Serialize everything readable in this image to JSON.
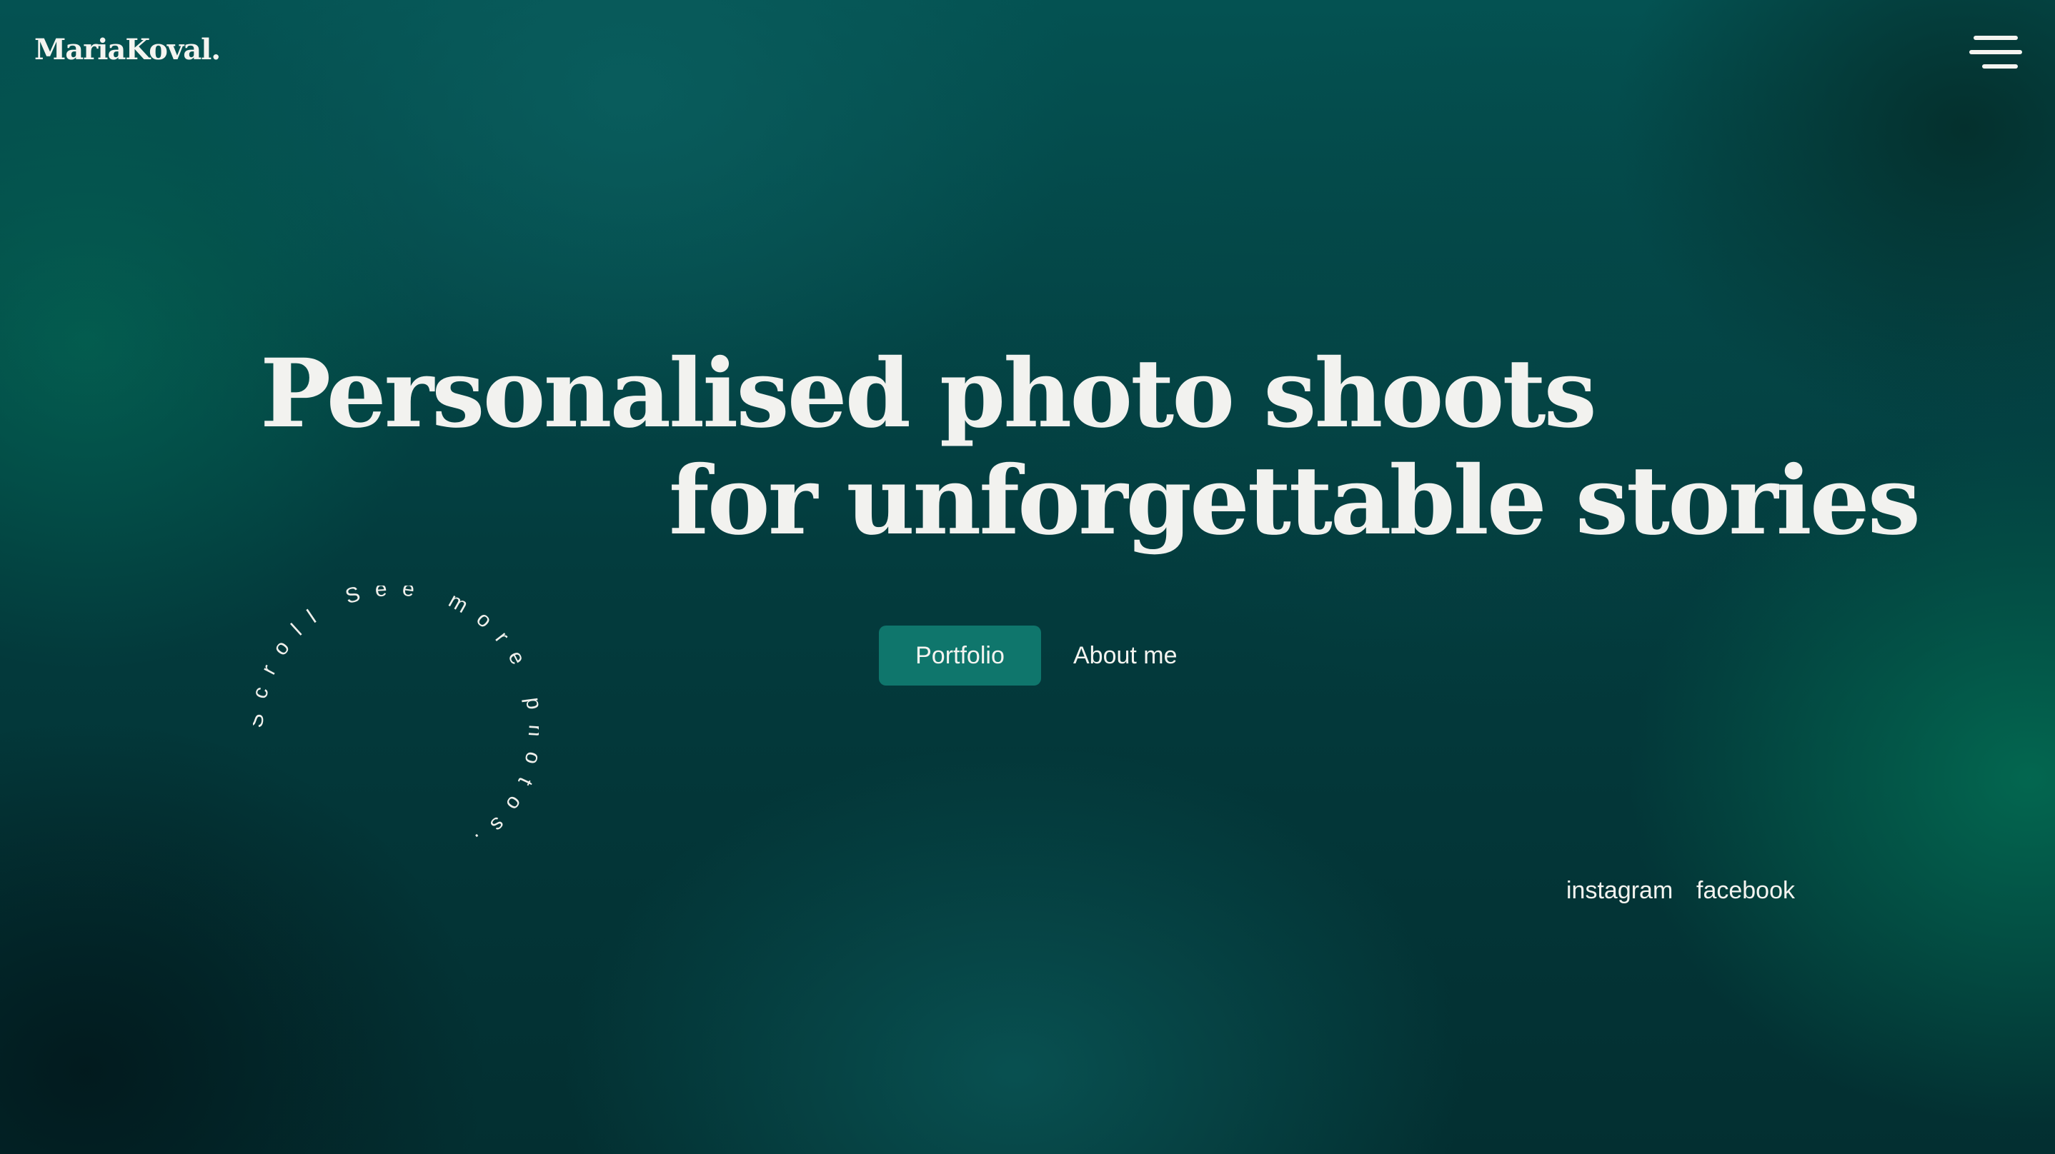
{
  "header": {
    "logo_text": "MariaKoval.",
    "menu_icon": "hamburger-menu-icon"
  },
  "hero": {
    "headline_line1": "Personalised photo shoots",
    "headline_line2": "for unforgettable stories",
    "primary_button_label": "Portfolio",
    "secondary_link_label": "About me"
  },
  "scroll_badge": {
    "text": "Scroll See more photos."
  },
  "social": {
    "instagram_label": "instagram",
    "facebook_label": "facebook"
  },
  "colors": {
    "background_primary": "#033a3a",
    "accent_button": "#0f766c",
    "text": "#f2f2ef"
  }
}
